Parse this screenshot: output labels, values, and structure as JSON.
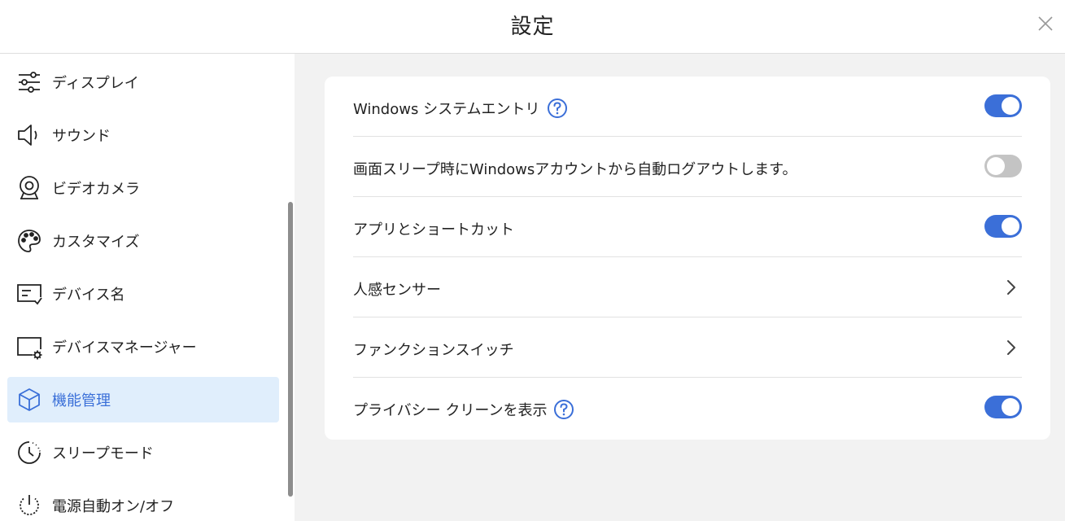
{
  "window": {
    "title": "設定"
  },
  "sidebar": {
    "items": [
      {
        "label": "ディスプレイ",
        "icon": "sliders-icon",
        "active": false
      },
      {
        "label": "サウンド",
        "icon": "speaker-icon",
        "active": false
      },
      {
        "label": "ビデオカメラ",
        "icon": "webcam-icon",
        "active": false
      },
      {
        "label": "カスタマイズ",
        "icon": "palette-icon",
        "active": false
      },
      {
        "label": "デバイス名",
        "icon": "device-name-icon",
        "active": false
      },
      {
        "label": "デバイスマネージャー",
        "icon": "device-manager-icon",
        "active": false
      },
      {
        "label": "機能管理",
        "icon": "cube-icon",
        "active": true
      },
      {
        "label": "スリープモード",
        "icon": "sleep-clock-icon",
        "active": false
      },
      {
        "label": "電源自動オン/オフ",
        "icon": "power-icon",
        "active": false
      }
    ]
  },
  "settings": {
    "rows": [
      {
        "label": "Windows システムエントリ",
        "help": true,
        "control": "toggle",
        "on": true
      },
      {
        "label": "画面スリープ時にWindowsアカウントから自動ログアウトします。",
        "help": false,
        "control": "toggle",
        "on": false
      },
      {
        "label": "アプリとショートカット",
        "help": false,
        "control": "toggle",
        "on": true
      },
      {
        "label": "人感センサー",
        "help": false,
        "control": "chevron"
      },
      {
        "label": "ファンクションスイッチ",
        "help": false,
        "control": "chevron"
      },
      {
        "label": "プライバシー クリーンを表示",
        "help": true,
        "control": "toggle",
        "on": true
      }
    ]
  },
  "colors": {
    "accent": "#3b6fd8",
    "active_bg": "#e0eefc",
    "toggle_off": "#c4c4c4",
    "background": "#f2f2f2"
  }
}
